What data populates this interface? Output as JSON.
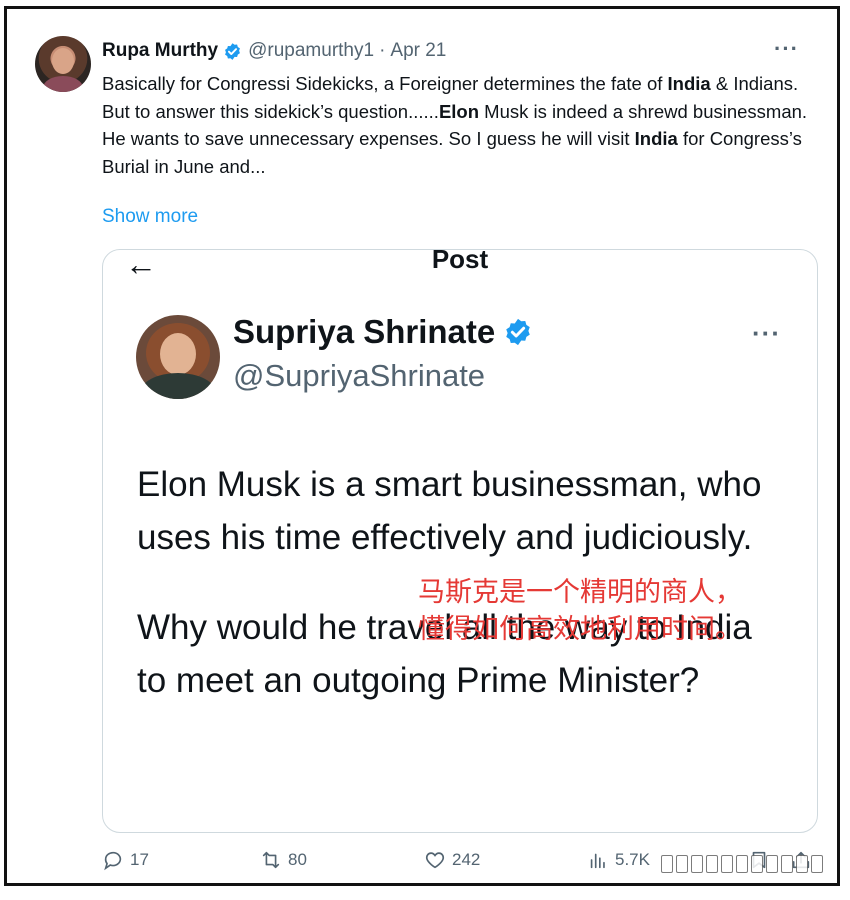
{
  "tweet": {
    "author_name": "Rupa Murthy",
    "handle": "@rupamurthy1",
    "separator": "·",
    "date": "Apr 21",
    "more_label": "···",
    "lines": {
      "l1a": "Basically for Congressi Sidekicks, a Foreigner determines the fate of ",
      "l1b": "India",
      "l1c": " & Indians.",
      "l2a": "But to answer this sidekick’s question......",
      "l2b": "Elon",
      "l2c": " Musk is indeed a shrewd businessman. He wants to save unnecessary expenses. So I guess he will visit ",
      "l2d": "India",
      "l2e": " for Congress’s Burial in June and..."
    },
    "show_more": "Show more"
  },
  "quoted": {
    "back_label": "←",
    "title": "Post",
    "author_name": "Supriya Shrinate",
    "handle": "@SupriyaShrinate",
    "more_label": "···",
    "para1": "Elon Musk is a smart businessman, who uses his time effectively and judiciously.",
    "para2": "Why would he travel all the way to India to meet an outgoing Prime Minister?",
    "translation_line1": "马斯克是一个精明的商人，",
    "translation_line2": "懂得如何高效地利用时间。"
  },
  "actions": {
    "replies": "17",
    "reposts": "80",
    "likes": "242",
    "views": "5.7K"
  },
  "colors": {
    "verified": "#1d9bf0",
    "link": "#1d9bf0",
    "annotation": "#e53935",
    "muted": "#536471"
  }
}
